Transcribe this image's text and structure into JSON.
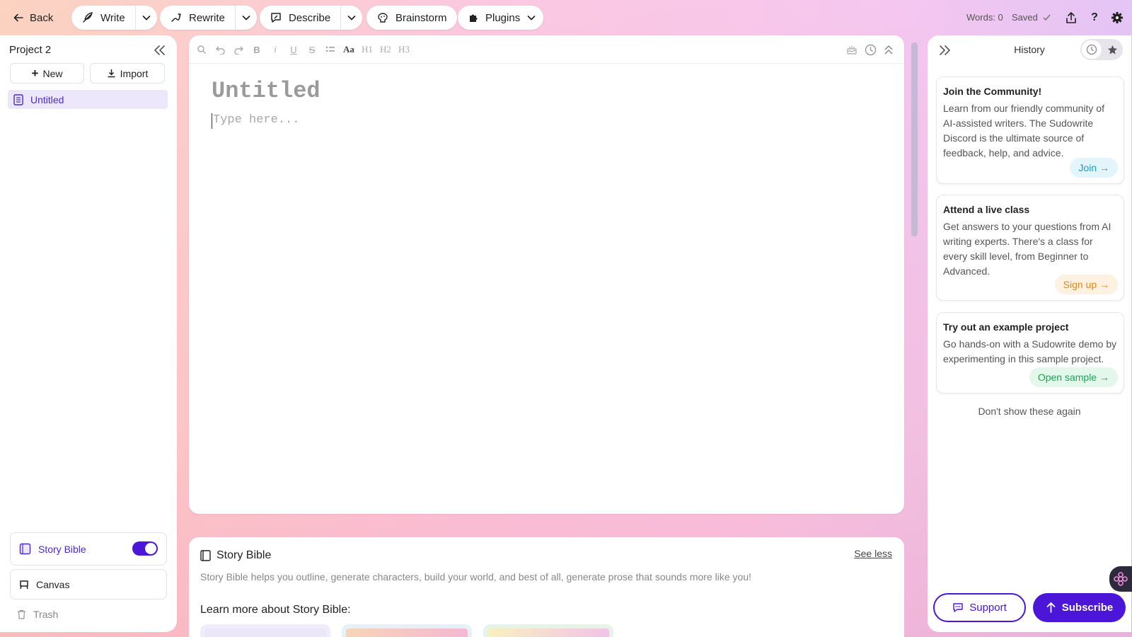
{
  "topbar": {
    "back_label": "Back",
    "write_label": "Write",
    "rewrite_label": "Rewrite",
    "describe_label": "Describe",
    "brainstorm_label": "Brainstorm",
    "plugins_label": "Plugins",
    "words_label": "Words: 0",
    "saved_label": "Saved"
  },
  "sidebar": {
    "project_title": "Project 2",
    "new_label": "New",
    "import_label": "Import",
    "documents": [
      {
        "label": "Untitled"
      }
    ],
    "story_bible_label": "Story Bible",
    "story_bible_enabled": true,
    "canvas_label": "Canvas",
    "trash_label": "Trash"
  },
  "editor": {
    "title_placeholder": "Untitled",
    "body_placeholder": "Type here...",
    "toolbar": {
      "font_label": "Aa",
      "h1": "H1",
      "h2": "H2",
      "h3": "H3"
    }
  },
  "story_bible": {
    "title": "Story Bible",
    "see_less": "See less",
    "description": "Story Bible helps you outline, generate characters, build your world, and best of all, generate prose that sounds more like you!",
    "learn_more": "Learn more about Story Bible:"
  },
  "history": {
    "title": "History",
    "cards": [
      {
        "title": "Join the Community!",
        "body": "Learn from our friendly community of AI-assisted writers. The Sudowrite Discord is the ultimate source of feedback, help, and advice.",
        "cta": "Join →",
        "cta_color": "#1a9fc0",
        "cta_bg": "#e3f5fa"
      },
      {
        "title": "Attend a live class",
        "body": "Get answers to your questions from AI writing experts. There's a class for every skill level, from Beginner to Advanced.",
        "cta": "Sign up →",
        "cta_color": "#e08a1e",
        "cta_bg": "#fdf1e1"
      },
      {
        "title": "Try out an example project",
        "body": "Go hands-on with a Sudowrite demo by experimenting in this sample project.",
        "cta": "Open sample →",
        "cta_color": "#1fa35a",
        "cta_bg": "#e3f7ea"
      }
    ],
    "dont_show": "Don't show these again",
    "support_label": "Support",
    "subscribe_label": "Subscribe"
  },
  "colors": {
    "accent": "#4b16d8",
    "selected_bg": "#ece7fb"
  }
}
